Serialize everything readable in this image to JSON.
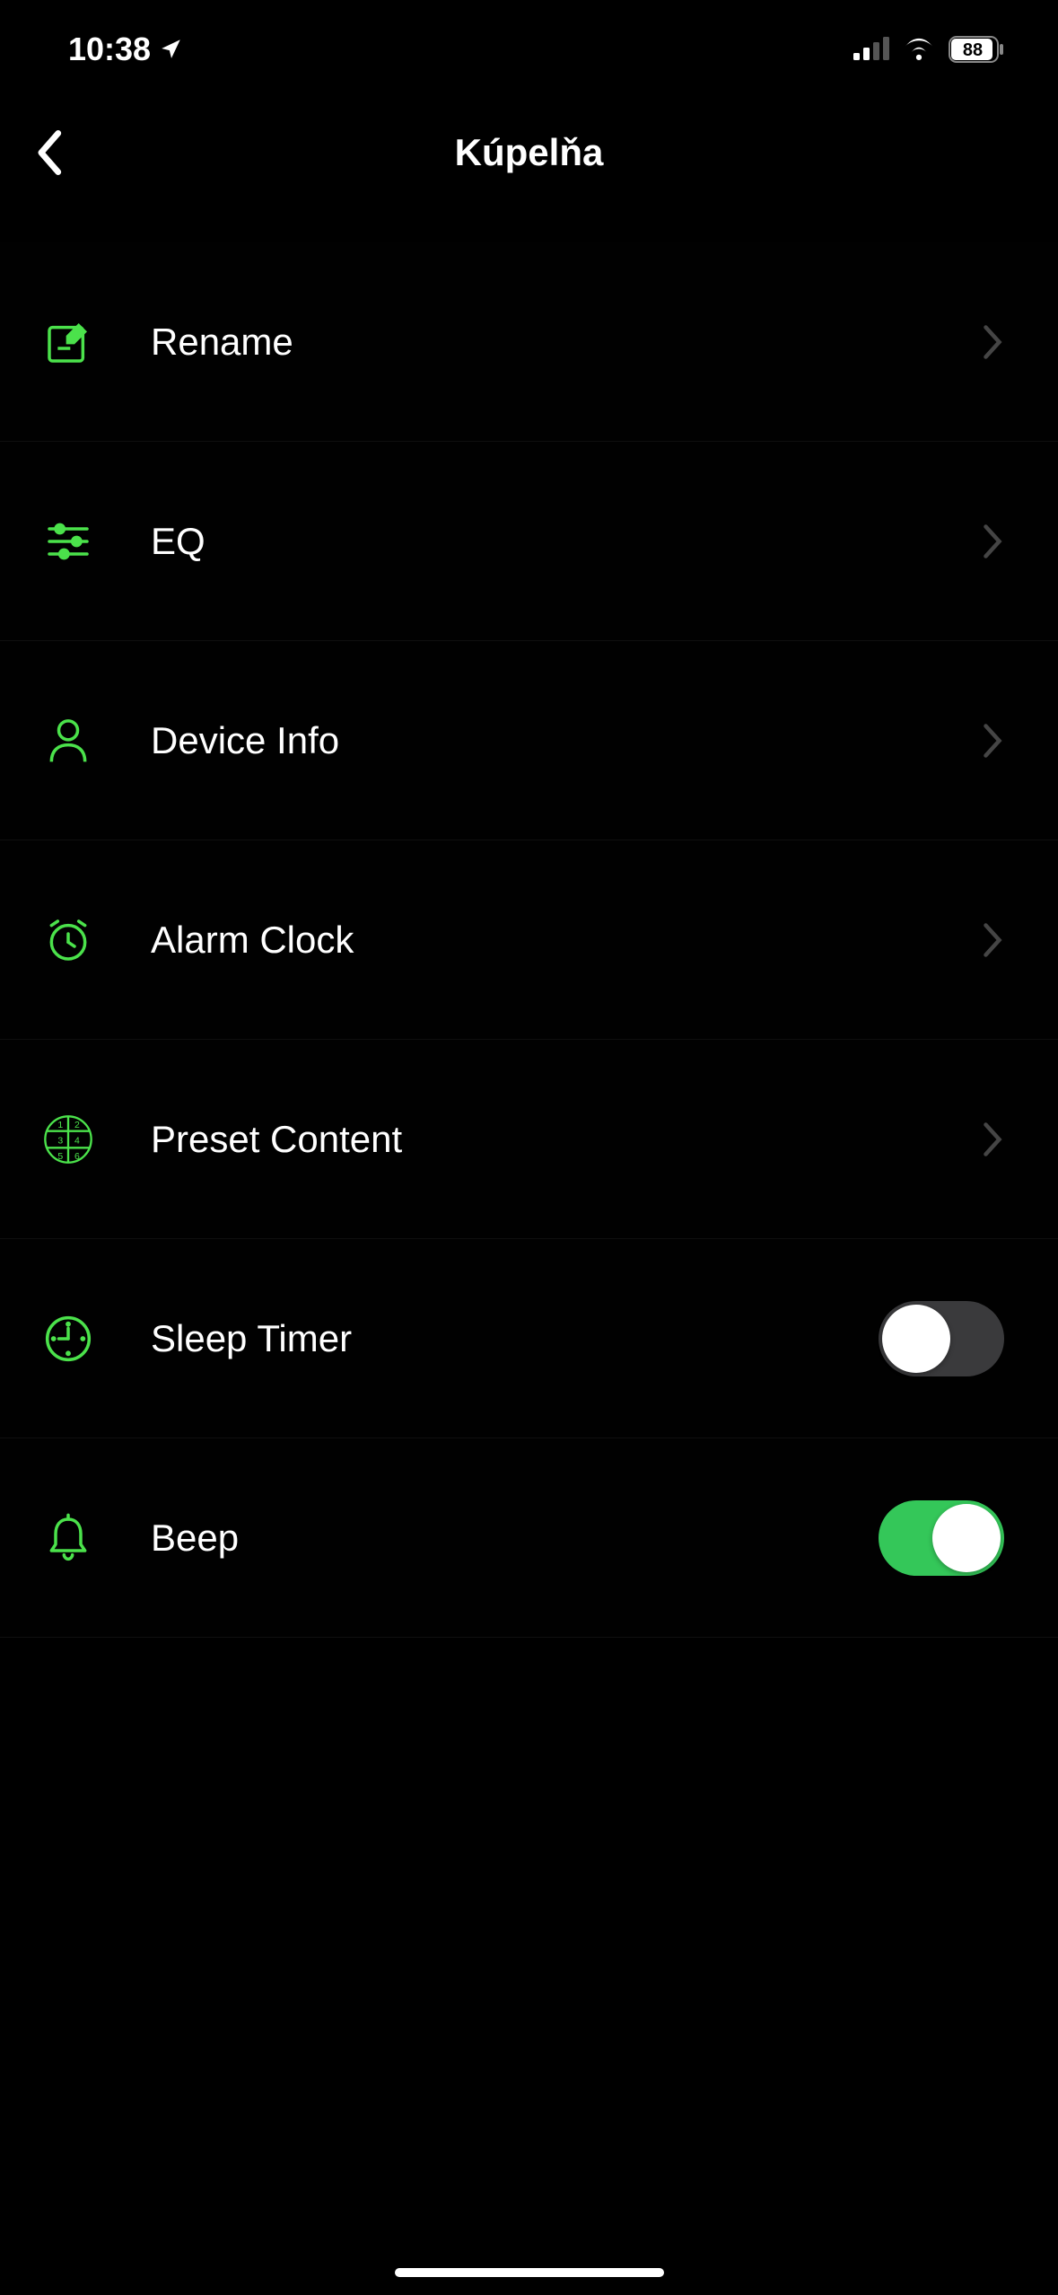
{
  "statusBar": {
    "time": "10:38",
    "battery": "88"
  },
  "header": {
    "title": "Kúpelňa"
  },
  "rows": [
    {
      "label": "Rename"
    },
    {
      "label": "EQ"
    },
    {
      "label": "Device Info"
    },
    {
      "label": "Alarm Clock"
    },
    {
      "label": "Preset Content"
    },
    {
      "label": "Sleep Timer",
      "toggle": false
    },
    {
      "label": "Beep",
      "toggle": true
    }
  ],
  "colors": {
    "accent": "#4be24b",
    "toggleOn": "#34c759"
  }
}
